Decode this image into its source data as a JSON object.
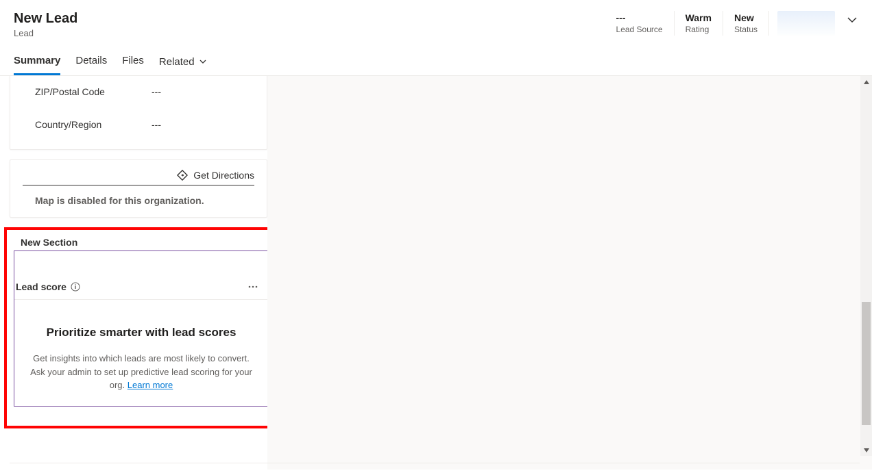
{
  "header": {
    "title": "New Lead",
    "subtitle": "Lead",
    "stats": [
      {
        "value": "---",
        "label": "Lead Source"
      },
      {
        "value": "Warm",
        "label": "Rating"
      },
      {
        "value": "New",
        "label": "Status"
      }
    ]
  },
  "tabs": {
    "items": [
      "Summary",
      "Details",
      "Files",
      "Related"
    ],
    "active": 0
  },
  "address": {
    "fields": [
      {
        "label": "ZIP/Postal Code",
        "value": "---"
      },
      {
        "label": "Country/Region",
        "value": "---"
      }
    ]
  },
  "map": {
    "directions_label": "Get Directions",
    "disabled_text": "Map is disabled for this organization."
  },
  "new_section": {
    "title": "New Section",
    "lead_score": {
      "title": "Lead score",
      "heading": "Prioritize smarter with lead scores",
      "body": "Get insights into which leads are most likely to convert. Ask your admin to set up predictive lead scoring for your org. ",
      "link_text": "Learn more"
    }
  }
}
